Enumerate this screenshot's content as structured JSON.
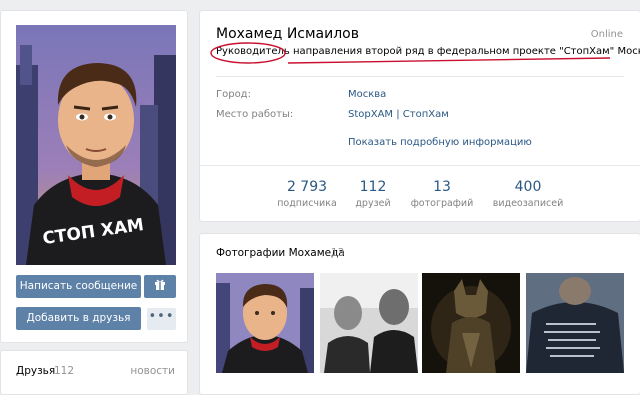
{
  "profile": {
    "name": "Мохамед Исмаилов",
    "online": "Online",
    "status_highlight": "Руководитель",
    "status_rest": " направления второй ряд в федеральном проекте \"СтопХам\" Москва",
    "fields": [
      {
        "label": "Город:",
        "value": "Москва"
      },
      {
        "label": "Место работы:",
        "value": "StopXAM | СтопХам"
      }
    ],
    "more_info": "Показать подробную информацию",
    "annotation_color": "#c8102e"
  },
  "counters": [
    {
      "value": "2 793",
      "caption": "подписчика"
    },
    {
      "value": "112",
      "caption": "друзей"
    },
    {
      "value": "13",
      "caption": "фотографий"
    },
    {
      "value": "400",
      "caption": "видеозаписей"
    }
  ],
  "actions": {
    "send_message": "Написать сообщение",
    "gift_icon": "gift-icon",
    "add_friend": "Добавить в друзья",
    "more": "•••"
  },
  "friends": {
    "label": "Друзья",
    "count": "112",
    "news": "новости"
  },
  "photos": {
    "title": "Фотографии Мохамеда",
    "count": "13"
  },
  "avatar_shirt_text": "СТОП ХАМ",
  "colors": {
    "accent": "#5e81a8",
    "link": "#2a5885",
    "background": "#edeef0"
  }
}
